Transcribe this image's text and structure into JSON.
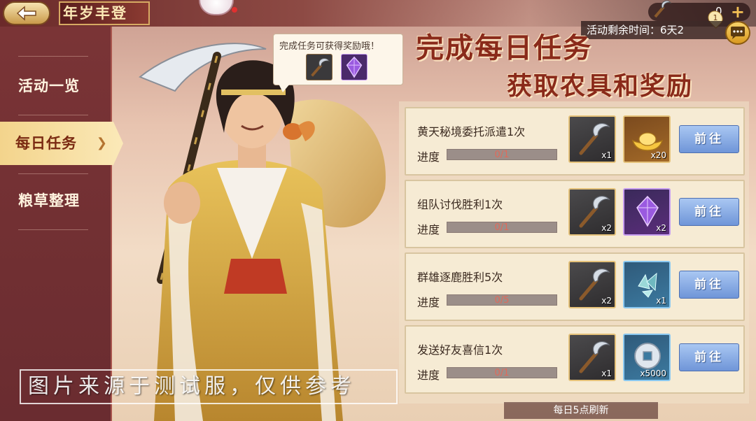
{
  "header": {
    "title": "年岁丰登",
    "currency_value": "0",
    "notification_count": "1",
    "timer_text": "活动剩余时间：6天2"
  },
  "sidebar": {
    "items": [
      {
        "label": "活动一览",
        "active": false
      },
      {
        "label": "每日任务",
        "active": true
      },
      {
        "label": "粮草整理",
        "active": false
      }
    ]
  },
  "tooltip": {
    "text": "完成任务可获得奖励哦！"
  },
  "headline": {
    "line1": "完成每日任务",
    "line2": "获取农具和奖励"
  },
  "tasks": [
    {
      "title": "黄天秘境委托派遣1次",
      "progress_label": "进度",
      "progress_text": "0/1",
      "progress": 0,
      "rewards": [
        {
          "icon": "sickle-icon",
          "count": "x1"
        },
        {
          "icon": "gold-ingot-icon",
          "count": "x20"
        }
      ],
      "button": "前往"
    },
    {
      "title": "组队讨伐胜利1次",
      "progress_label": "进度",
      "progress_text": "0/1",
      "progress": 0,
      "rewards": [
        {
          "icon": "sickle-icon",
          "count": "x2"
        },
        {
          "icon": "purple-crystal-icon",
          "count": "x2"
        }
      ],
      "button": "前往"
    },
    {
      "title": "群雄逐鹿胜利5次",
      "progress_label": "进度",
      "progress_text": "0/5",
      "progress": 0,
      "rewards": [
        {
          "icon": "sickle-icon",
          "count": "x2"
        },
        {
          "icon": "crystal-shard-icon",
          "count": "x1"
        }
      ],
      "button": "前往"
    },
    {
      "title": "发送好友喜信1次",
      "progress_label": "进度",
      "progress_text": "0/1",
      "progress": 0,
      "rewards": [
        {
          "icon": "sickle-icon",
          "count": "x1"
        },
        {
          "icon": "silver-coin-icon",
          "count": "x5000"
        }
      ],
      "button": "前往"
    }
  ],
  "footer": {
    "refresh_note": "每日5点刷新"
  },
  "watermark": "图片来源于测试服，仅供参考",
  "colors": {
    "accent_red": "#8a2a1a",
    "button_blue": "#6f95d8",
    "sidebar": "#7a3436",
    "progress_red": "#e06a5a"
  }
}
